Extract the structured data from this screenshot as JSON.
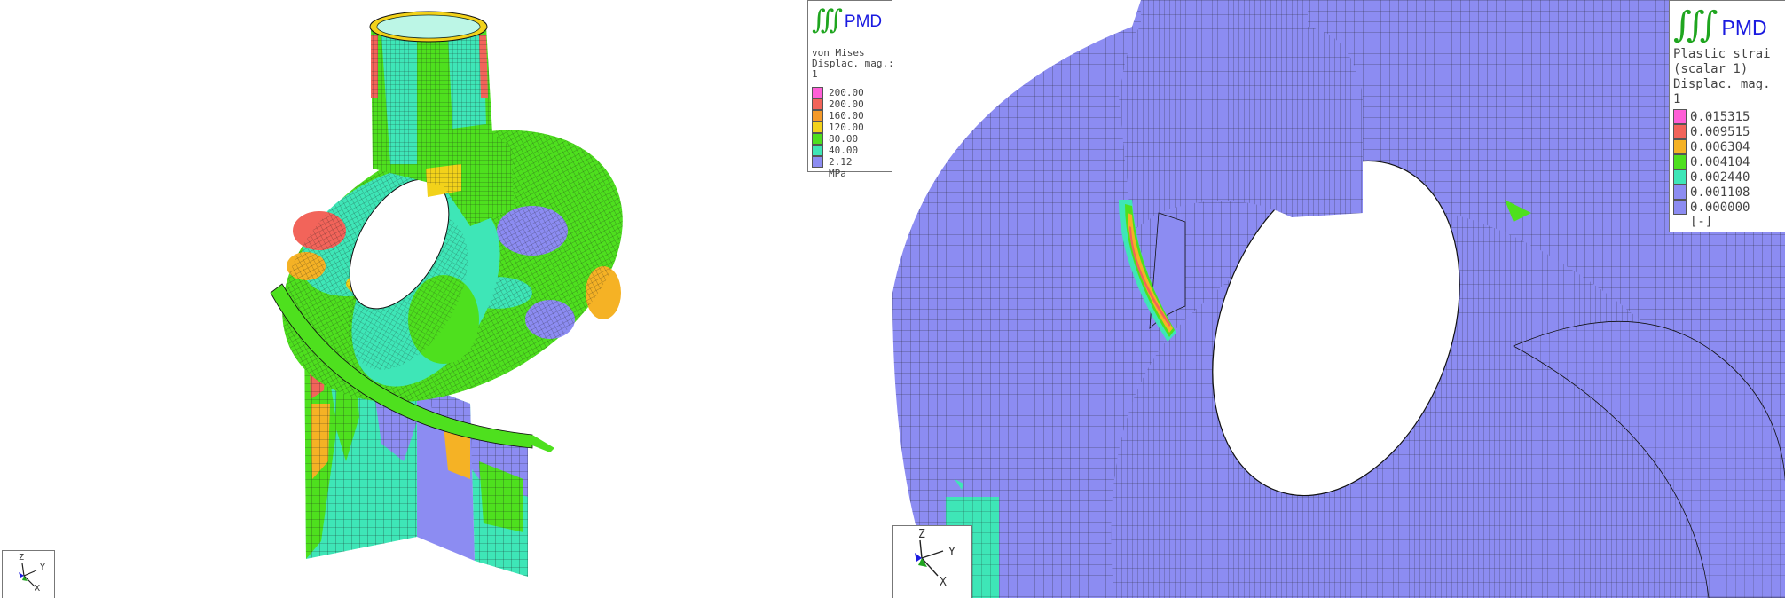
{
  "left_view": {
    "logo": {
      "integral_glyph": "∫∫∫",
      "brand": "PMD"
    },
    "legend": {
      "line1": "von Mises",
      "line2": "Displac. mag.:",
      "line3": "1",
      "levels": [
        {
          "label": "200.00",
          "color": "#ff5fd7"
        },
        {
          "label": "200.00",
          "color": "#f2645a"
        },
        {
          "label": "160.00",
          "color": "#f59a2a"
        },
        {
          "label": "120.00",
          "color": "#f2d21a"
        },
        {
          "label": "80.00",
          "color": "#4ee01e"
        },
        {
          "label": "40.00",
          "color": "#3ee6b7"
        },
        {
          "label": "2.12",
          "color": "#8c8cf2"
        }
      ],
      "unit": "MPa"
    },
    "triad": {
      "z": "Z",
      "y": "Y",
      "x": "X"
    }
  },
  "right_view": {
    "logo": {
      "integral_glyph": "∫∫∫",
      "brand": "PMD"
    },
    "legend": {
      "line1": "Plastic strai",
      "line2": "(scalar 1)",
      "line3": "Displac. mag.",
      "line4": "1",
      "levels": [
        {
          "label": "0.015315",
          "color": "#ff5fd7"
        },
        {
          "label": "0.009515",
          "color": "#f2645a"
        },
        {
          "label": "0.006304",
          "color": "#f5b225"
        },
        {
          "label": "0.004104",
          "color": "#4ee01e"
        },
        {
          "label": "0.002440",
          "color": "#3ee6b7"
        },
        {
          "label": "0.001108",
          "color": "#8c8cf2"
        },
        {
          "label": "0.000000",
          "color": "#8c8cf2"
        }
      ],
      "unit": "[-]"
    },
    "triad": {
      "z": "Z",
      "y": "Y",
      "x": "X"
    }
  }
}
